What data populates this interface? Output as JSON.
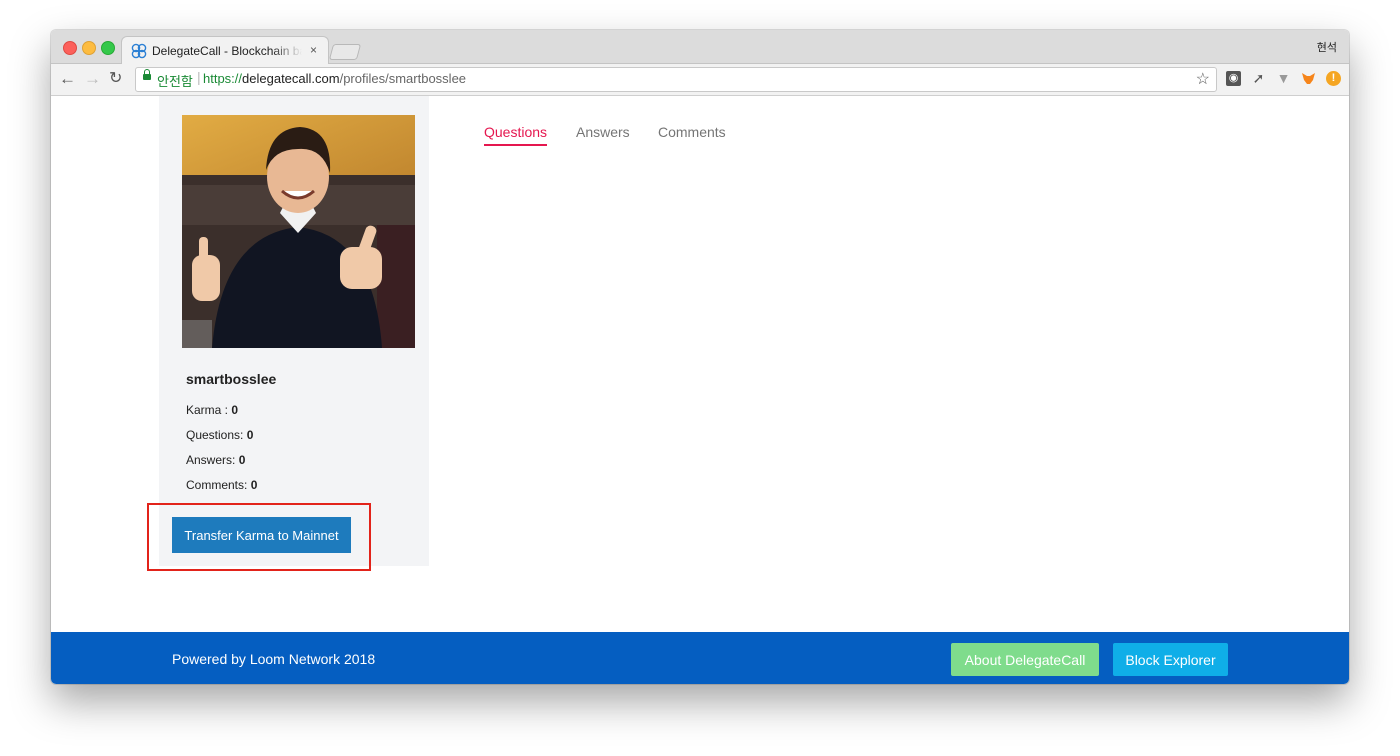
{
  "browser": {
    "tab_title": "DelegateCall - Blockchain based",
    "tab_close": "×",
    "profile_name": "현석",
    "secure_label": "안전함",
    "url_scheme": "https://",
    "url_host": "delegatecall.com",
    "url_path": "/profiles/smartbosslee",
    "nav_icons": [
      "back-arrow-icon",
      "forward-arrow-icon",
      "reload-icon"
    ],
    "extension_icons": [
      "extension-icon",
      "rocket-icon",
      "vue-icon",
      "metamask-icon",
      "warning-icon"
    ],
    "accent_secure": "#1a8a35"
  },
  "profile": {
    "username": "smartbosslee",
    "stats": [
      {
        "label": "Karma : ",
        "value": "0"
      },
      {
        "label": "Questions: ",
        "value": "0"
      },
      {
        "label": "Answers: ",
        "value": "0"
      },
      {
        "label": "Comments: ",
        "value": "0"
      }
    ],
    "transfer_button": "Transfer Karma to Mainnet"
  },
  "content_tabs": [
    {
      "label": "Questions",
      "active": true
    },
    {
      "label": "Answers",
      "active": false
    },
    {
      "label": "Comments",
      "active": false
    }
  ],
  "footer": {
    "text": "Powered by Loom Network 2018",
    "about_button": "About DelegateCall",
    "explorer_button": "Block Explorer"
  },
  "colors": {
    "active_tab": "#e5174f",
    "footer_bg": "#055ec1",
    "transfer_button": "#1e7bbd",
    "about_button": "#7fdc8c",
    "explorer_button": "#0faee8",
    "highlight": "#e2231a"
  }
}
